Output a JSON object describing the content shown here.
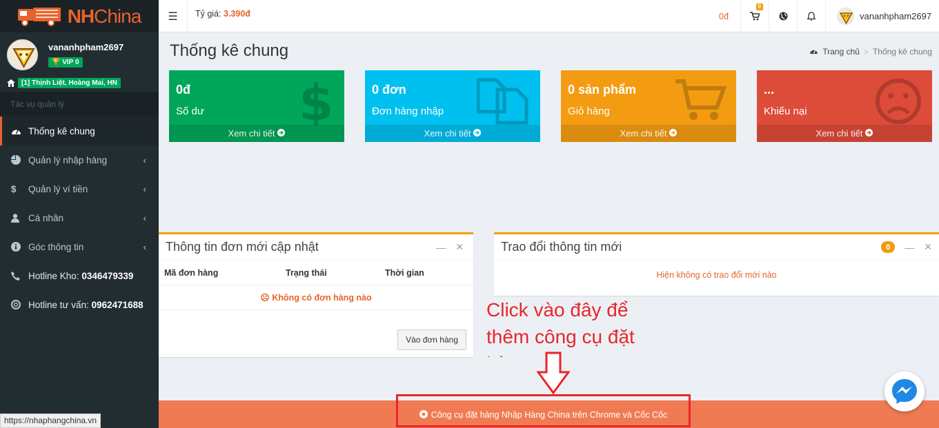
{
  "brand": {
    "name_part1": "NH",
    "name_part2": "China"
  },
  "header": {
    "rate_label": "Tỷ giá:",
    "rate_value": "3.390đ",
    "balance": "0đ",
    "cart_count": "0",
    "username": "vananhpham2697"
  },
  "sidebar": {
    "username": "vananhpham2697",
    "vip": "VIP 0",
    "address": "[1] Thịnh Liệt, Hoàng Mai, HN",
    "section_label": "Tác vụ quản lý",
    "items": [
      {
        "label": "Thống kê chung",
        "icon": "dashboard-icon"
      },
      {
        "label": "Quản lý nhập hàng",
        "icon": "pie-chart-icon"
      },
      {
        "label": "Quản lý ví tiền",
        "icon": "dollar-icon"
      },
      {
        "label": "Cá nhân",
        "icon": "user-icon"
      },
      {
        "label": "Góc thông tin",
        "icon": "info-icon"
      }
    ],
    "hotline_kho_label": "Hotline Kho:",
    "hotline_kho_number": "0346479339",
    "hotline_tv_label": "Hotline tư vấn:",
    "hotline_tv_number": "0962471688"
  },
  "page": {
    "title": "Thống kê chung",
    "breadcrumb_home": "Trang chủ",
    "breadcrumb_sep": ">",
    "breadcrumb_current": "Thống kê chung"
  },
  "stats": [
    {
      "value": "0đ",
      "label": "Số dư",
      "footer": "Xem chi tiết",
      "color": "#00a65a",
      "icon": "dollar-icon"
    },
    {
      "value": "0 đơn",
      "label": "Đơn hàng nhập",
      "footer": "Xem chi tiết",
      "color": "#00c0ef",
      "icon": "files-icon"
    },
    {
      "value": "0 sản phẩm",
      "label": "Giỏ hàng",
      "footer": "Xem chi tiết",
      "color": "#f39c12",
      "icon": "cart-icon"
    },
    {
      "value": "...",
      "label": "Khiếu nại",
      "footer": "Xem chi tiết",
      "color": "#dd4b39",
      "icon": "sad-face-icon"
    }
  ],
  "orders_box": {
    "title": "Thông tin đơn mới cập nhật",
    "columns": [
      "Mã đơn hàng",
      "Trạng thái",
      "Thời gian"
    ],
    "empty_text": "Không có đơn hàng nào",
    "button": "Vào đơn hàng"
  },
  "messages_box": {
    "title": "Trao đổi thông tin mới",
    "count": "0",
    "empty_text": "Hiện không có trao đổi mới nào"
  },
  "annotation": {
    "text": "Click vào đây để thêm công cụ đặt hàng"
  },
  "footer": {
    "link_text": "Công cụ đặt hàng Nhập Hàng China trên Chrome và Cốc Cốc"
  },
  "status_bar": {
    "url": "https://nhaphangchina.vn"
  }
}
